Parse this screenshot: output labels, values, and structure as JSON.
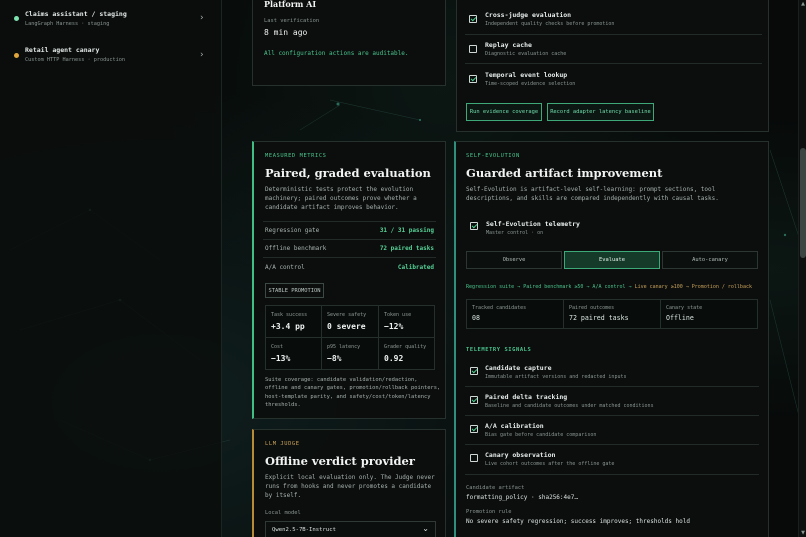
{
  "colors": {
    "accent": "#3fbf86",
    "gold": "#caa25a",
    "bg": "#070a09"
  },
  "sidebar": {
    "items": [
      {
        "title": "Claims assistant / staging",
        "subtitle": "LangGraph Harness · staging",
        "dot_color": "#7ee2b0"
      },
      {
        "title": "Retail agent canary",
        "subtitle": "Custom HTTP Harness · production",
        "dot_color": "#e0a63c"
      }
    ]
  },
  "config_panel": {
    "platform": "Platform AI",
    "last_verification_label": "Last verification",
    "last_verification_value": "8 min ago",
    "auditable_note": "All configuration actions are auditable."
  },
  "checks_panel": {
    "items": [
      {
        "title": "Cross-judge evaluation",
        "subtitle": "Independent quality checks before promotion",
        "checked": true
      },
      {
        "title": "Replay cache",
        "subtitle": "Diagnostic evaluation cache",
        "checked": false
      },
      {
        "title": "Temporal event lookup",
        "subtitle": "Time-scoped evidence selection",
        "checked": true
      }
    ],
    "run_button": "Run evidence coverage",
    "record_button": "Record adapter latency baseline"
  },
  "measured": {
    "eyebrow": "MEASURED METRICS",
    "title": "Paired, graded evaluation",
    "description": "Deterministic tests protect the evolution machinery; paired outcomes prove whether a candidate artifact improves behavior.",
    "rows": [
      {
        "key": "Regression gate",
        "value": "31 / 31 passing"
      },
      {
        "key": "Offline benchmark",
        "value": "72 paired tasks"
      },
      {
        "key": "A/A control",
        "value": "Calibrated"
      }
    ],
    "tag": "STABLE PROMOTION",
    "metrics": [
      {
        "label": "Task success",
        "value": "+3.4 pp"
      },
      {
        "label": "Severe safety",
        "value": "0 severe"
      },
      {
        "label": "Token use",
        "value": "−12%"
      },
      {
        "label": "Cost",
        "value": "−13%"
      },
      {
        "label": "p95 latency",
        "value": "−8%"
      },
      {
        "label": "Grader quality",
        "value": "0.92"
      }
    ],
    "suite_coverage": "Suite coverage: candidate validation/redaction, offline and canary gates, promotion/rollback pointers, host-template parity, and safety/cost/token/latency thresholds."
  },
  "judge": {
    "eyebrow": "LLM JUDGE",
    "title": "Offline verdict provider",
    "description": "Explicit local evaluation only. The Judge never runs from hooks and never promotes a candidate by itself.",
    "model_label": "Local model",
    "model_value": "Qwen2.5-7B-Instruct"
  },
  "self_evolution": {
    "eyebrow": "SELF-EVOLUTION",
    "title": "Guarded artifact improvement",
    "description": "Self-Evolution is artifact-level self-learning: prompt sections, tool descriptions, and skills are compared independently with causal tasks.",
    "telemetry_toggle": {
      "title": "Self-Evolution telemetry",
      "subtitle": "Master control · on",
      "checked": true
    },
    "segments": [
      {
        "label": "Observe",
        "active": false
      },
      {
        "label": "Evaluate",
        "active": true
      },
      {
        "label": "Auto-canary",
        "active": false
      }
    ],
    "pipeline": {
      "prefix": "Regression suite → Paired benchmark ≥50 → A/A control → ",
      "highlight": "Live canary ≥100 → Promotion / rollback"
    },
    "stats": [
      {
        "label": "Tracked candidates",
        "value": "08"
      },
      {
        "label": "Paired outcomes",
        "value": "72 paired tasks"
      },
      {
        "label": "Canary state",
        "value": "Offline"
      }
    ],
    "signals_heading": "TELEMETRY SIGNALS",
    "signals": [
      {
        "title": "Candidate capture",
        "subtitle": "Immutable artifact versions and redacted inputs",
        "checked": true
      },
      {
        "title": "Paired delta tracking",
        "subtitle": "Baseline and candidate outcomes under matched conditions",
        "checked": true
      },
      {
        "title": "A/A calibration",
        "subtitle": "Bias gate before candidate comparison",
        "checked": true
      },
      {
        "title": "Canary observation",
        "subtitle": "Live cohort outcomes after the offline gate",
        "checked": false
      }
    ],
    "candidate_label": "Candidate artifact",
    "candidate_value": "formatting_policy · sha256:4e7…",
    "promotion_label": "Promotion rule",
    "promotion_value": "No severe safety regression; success improves; thresholds hold"
  }
}
